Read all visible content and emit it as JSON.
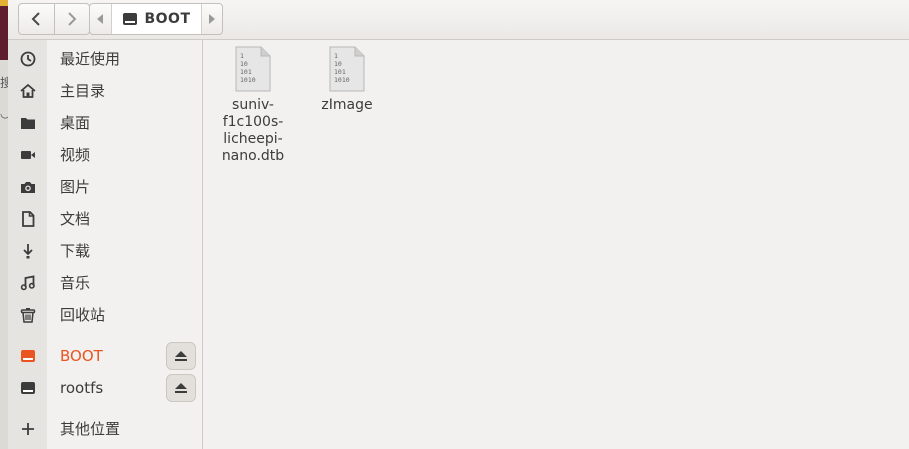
{
  "pathbar": {
    "current": "BOOT"
  },
  "sidebar": {
    "items": [
      {
        "label": "最近使用",
        "icon": "clock-icon"
      },
      {
        "label": "主目录",
        "icon": "home-icon"
      },
      {
        "label": "桌面",
        "icon": "folder-icon"
      },
      {
        "label": "视频",
        "icon": "video-icon"
      },
      {
        "label": "图片",
        "icon": "camera-icon"
      },
      {
        "label": "文档",
        "icon": "document-icon"
      },
      {
        "label": "下载",
        "icon": "download-icon"
      },
      {
        "label": "音乐",
        "icon": "music-icon"
      },
      {
        "label": "回收站",
        "icon": "trash-icon"
      }
    ],
    "devices": [
      {
        "label": "BOOT",
        "icon": "drive-icon",
        "active": true
      },
      {
        "label": "rootfs",
        "icon": "drive-icon",
        "active": false
      }
    ],
    "other": {
      "label": "其他位置",
      "icon": "plus-icon"
    }
  },
  "files": [
    {
      "name": "suniv-f1c100s-licheepi-nano.dtb",
      "name_lines": [
        "suniv-",
        "f1c100s-",
        "licheepi-",
        "nano.dtb"
      ],
      "icon_lines": [
        "1",
        "10",
        "101",
        "1010"
      ]
    },
    {
      "name": "zImage",
      "name_lines": [
        "zImage"
      ],
      "icon_lines": [
        "1",
        "10",
        "101",
        "1010"
      ]
    }
  ],
  "colors": {
    "accent": "#e95420",
    "background": "#f2f1f0",
    "sidebar_icon_column": "#e6e4e0"
  }
}
